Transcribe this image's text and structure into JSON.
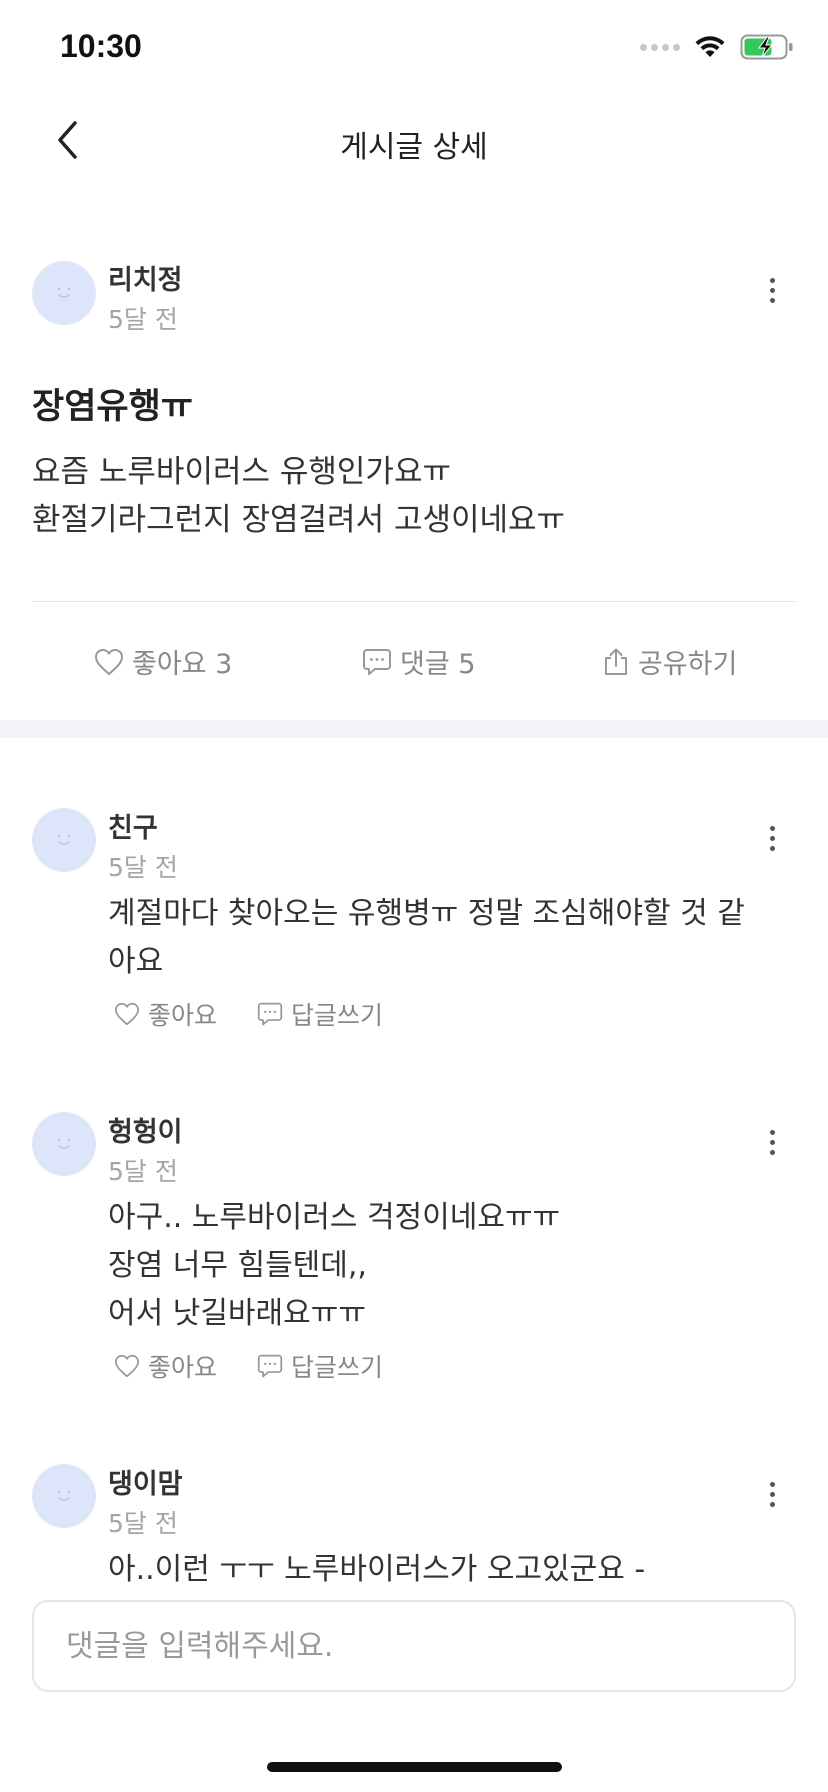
{
  "status_bar": {
    "time": "10:30"
  },
  "nav": {
    "title": "게시글 상세"
  },
  "post": {
    "author": "리치정",
    "time": "5달 전",
    "title": "장염유행ㅠ",
    "body_lines": [
      "요즘 노루바이러스 유행인가요ㅠ",
      "환절기라그런지 장염걸려서 고생이네요ㅠ"
    ]
  },
  "actions": {
    "like_label": "좋아요 3",
    "comment_label": "댓글 5",
    "share_label": "공유하기"
  },
  "comments": [
    {
      "author": "친구",
      "time": "5달 전",
      "body_lines": [
        "계절마다 찾아오는 유행병ㅠ 정말 조심해야할 것 같",
        "아요"
      ],
      "like_label": "좋아요",
      "reply_label": "답글쓰기"
    },
    {
      "author": "헝헝이",
      "time": "5달 전",
      "body_lines": [
        "아구.. 노루바이러스 걱정이네요ㅠㅠ",
        "장염 너무 힘들텐데,,",
        "어서 낫길바래요ㅠㅠ"
      ],
      "like_label": "좋아요",
      "reply_label": "답글쓰기"
    },
    {
      "author": "댕이맘",
      "time": "5달 전",
      "body_lines": [
        "아..이런 ㅜㅜ 노루바이러스가 오고있군요 -"
      ]
    }
  ],
  "input": {
    "placeholder": "댓글을 입력해주세요."
  },
  "colors": {
    "accent_gray": "#888888",
    "avatar_bg": "#dde5fb",
    "battery_green": "#34c759"
  }
}
